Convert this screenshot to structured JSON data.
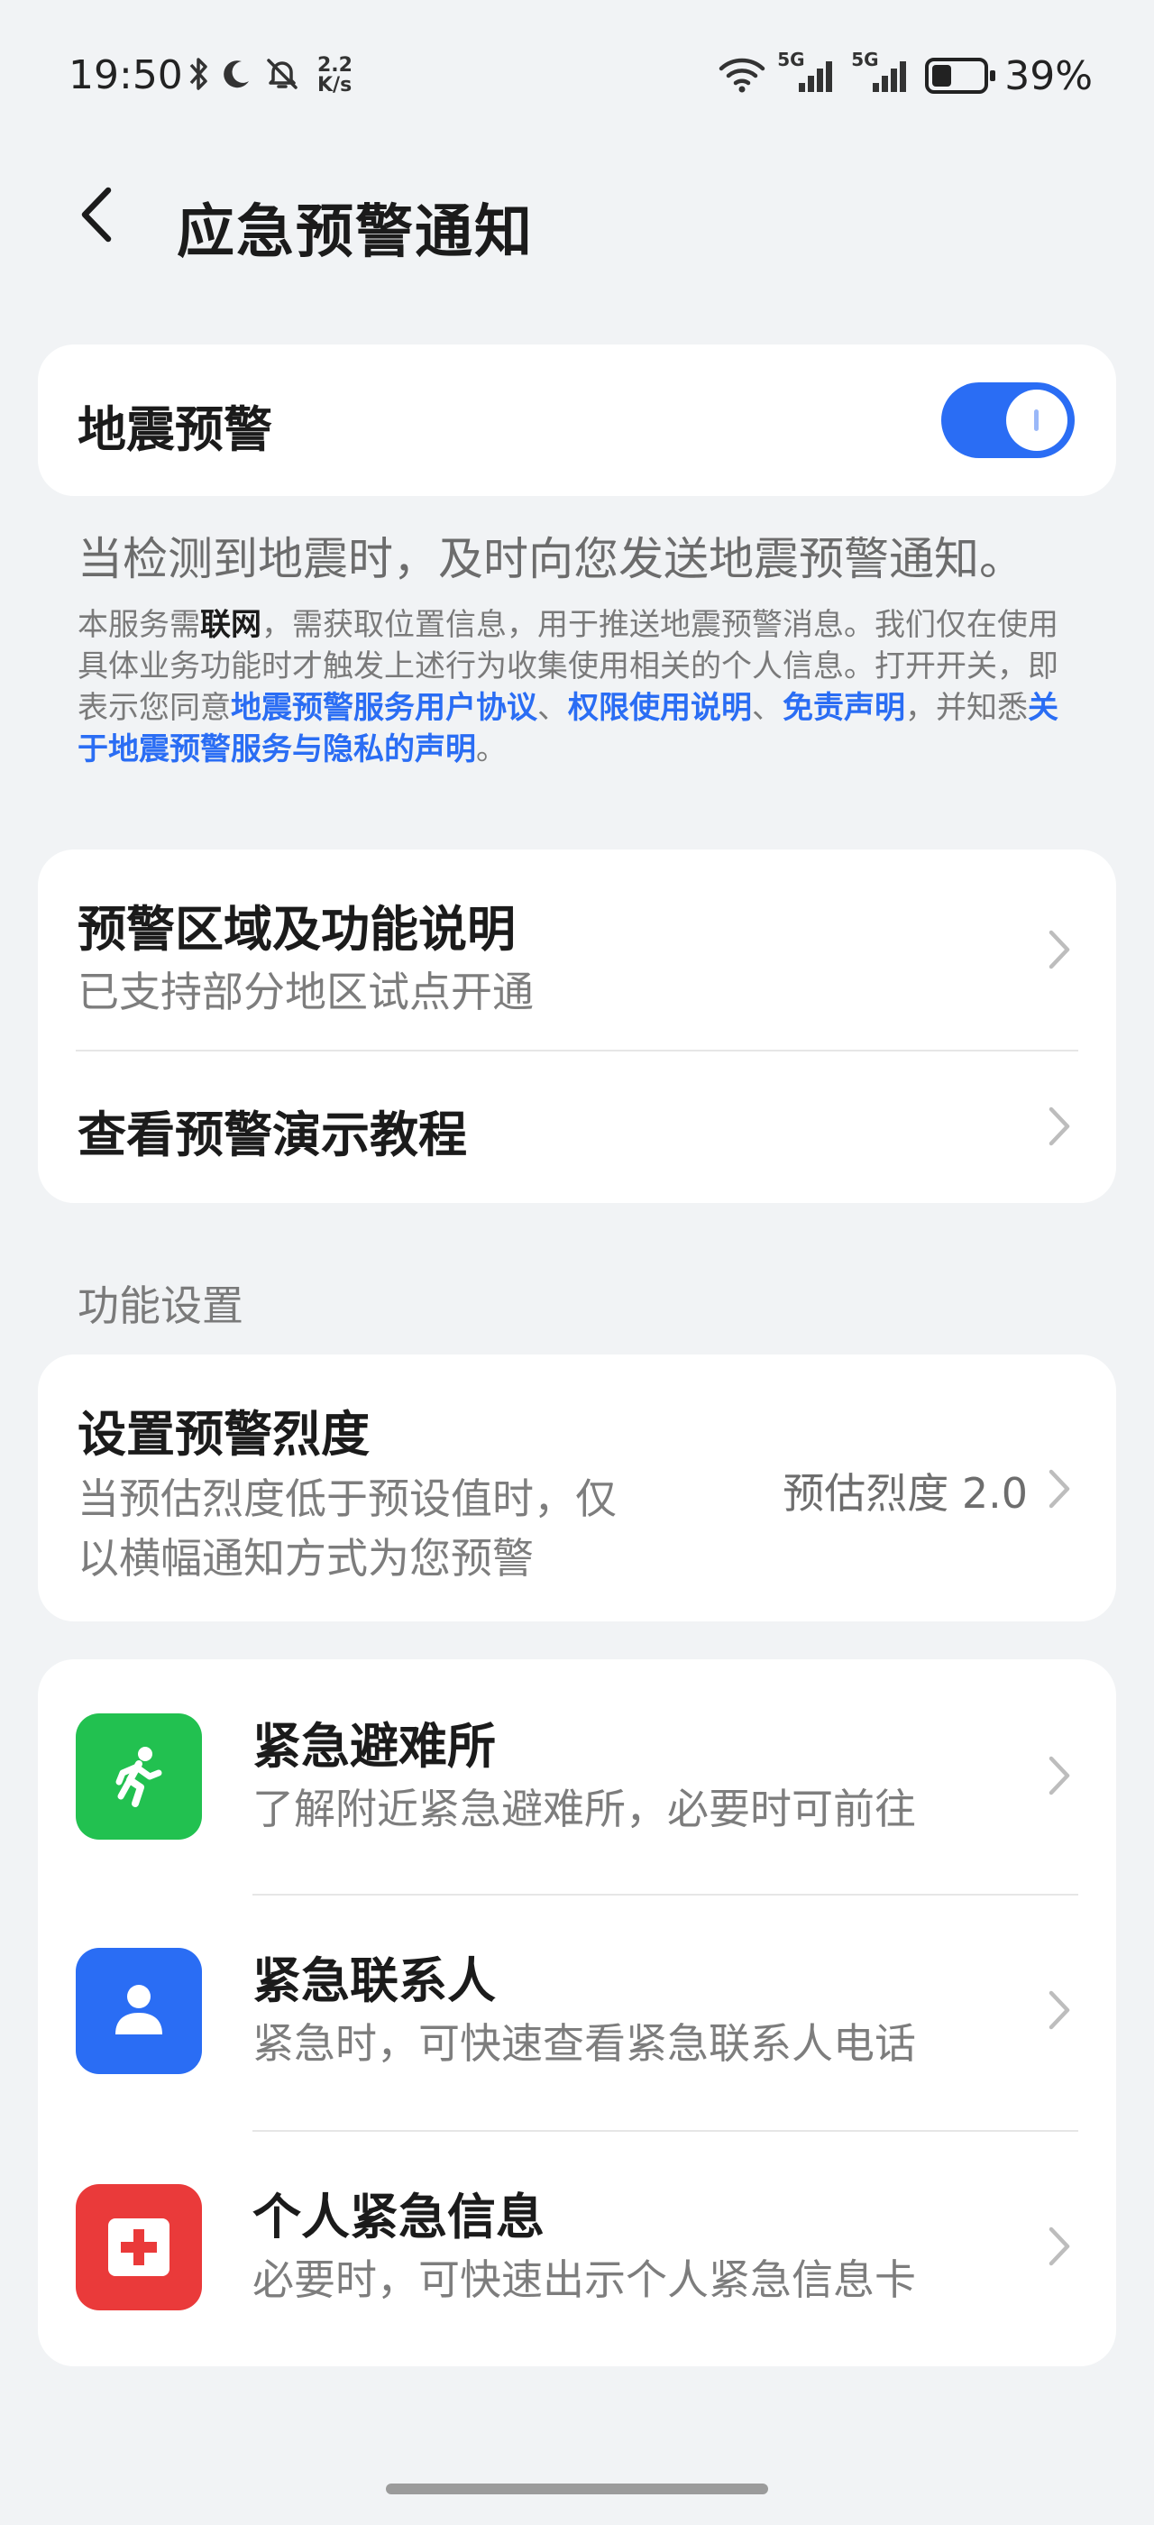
{
  "status_bar": {
    "time": "19:50",
    "speed_value": "2.2",
    "speed_unit": "K/s",
    "network_1": "5G",
    "network_2": "5G",
    "battery_percent": "39%",
    "battery_level": 0.39,
    "icons": [
      "bluetooth-icon",
      "moon-icon",
      "bell-off-icon",
      "wifi-icon",
      "signal-icon",
      "battery-icon"
    ]
  },
  "header": {
    "title": "应急预警通知",
    "back_icon": "chevron-left-icon"
  },
  "earthquake_alert": {
    "label": "地震预警",
    "toggle_on": true,
    "description": "当检测到地震时，及时向您发送地震预警通知。",
    "legal": {
      "part1": "本服务需",
      "bold1": "联网",
      "part2": "，需获取位置信息，用于推送地震预警消息。我们仅在使用具体业务功能时才触发上述行为收集使用相关的个人信息。打开开关，即表示您同意",
      "link1": "地震预警服务用户协议",
      "sep1": "、",
      "link2": "权限使用说明",
      "sep2": "、",
      "link3": "免责声明",
      "part3": "，并知悉",
      "link4": "关于地震预警服务与隐私的声明",
      "part4": "。"
    }
  },
  "info_card": {
    "item1_title": "预警区域及功能说明",
    "item1_sub": "已支持部分地区试点开通",
    "item2_title": "查看预警演示教程"
  },
  "section_label": "功能设置",
  "intensity_card": {
    "title": "设置预警烈度",
    "sub_line1": "当预估烈度低于预设值时，仅",
    "sub_line2": "以横幅通知方式为您预警",
    "value": "预估烈度 2.0"
  },
  "emergency_card": {
    "items": [
      {
        "title": "紧急避难所",
        "sub": "了解附近紧急避难所，必要时可前往",
        "icon": "running-person-icon",
        "color": "#22c150"
      },
      {
        "title": "紧急联系人",
        "sub": "紧急时，可快速查看紧急联系人电话",
        "icon": "person-icon",
        "color": "#2a6df4"
      },
      {
        "title": "个人紧急信息",
        "sub": "必要时，可快速出示个人紧急信息卡",
        "icon": "medical-cross-icon",
        "color": "#ea3a3a"
      }
    ]
  },
  "colors": {
    "accent": "#2a6df4",
    "background": "#f1f3f5"
  }
}
